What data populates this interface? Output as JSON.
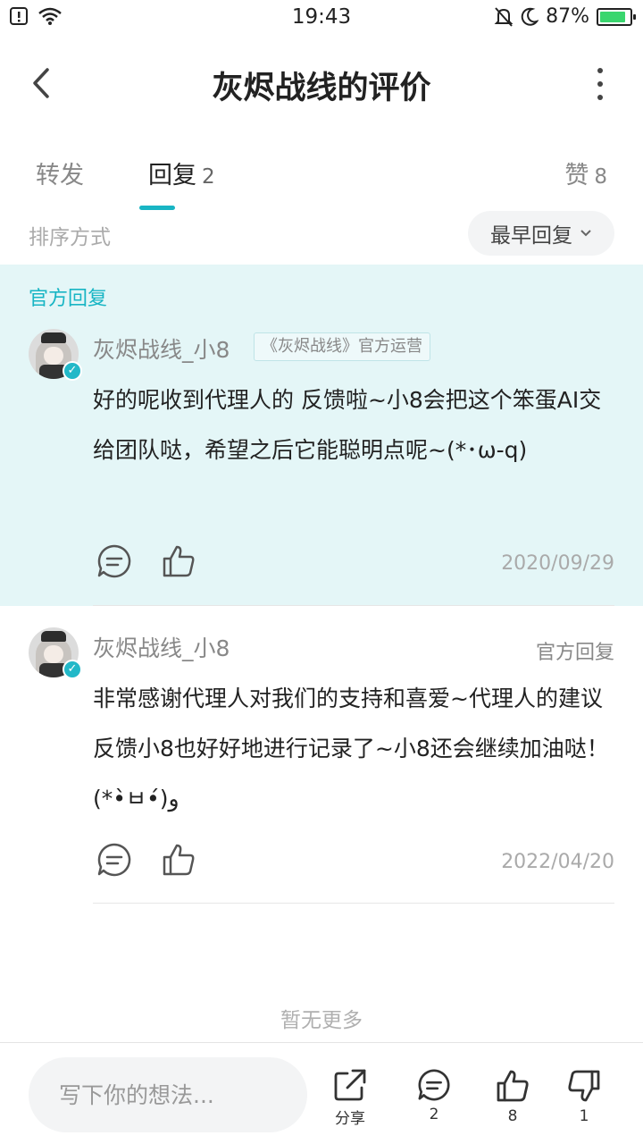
{
  "status_bar": {
    "time": "19:43",
    "battery": "87%",
    "battery_level": 0.87
  },
  "header": {
    "title": "灰烬战线的评价"
  },
  "tabs": [
    {
      "label": "转发",
      "count": ""
    },
    {
      "label": "回复",
      "count": "2"
    },
    {
      "label": "赞",
      "count": "8"
    }
  ],
  "sort": {
    "label": "排序方式",
    "value": "最早回复"
  },
  "replies": [
    {
      "section_label": "官方回复",
      "username": "灰烬战线_小8",
      "badge": "《灰烬战线》官方运营",
      "text": "好的呢收到代理人的 反馈啦~小8会把这个笨蛋AI交给团队哒，希望之后它能聪明点呢~(*･ω-q)",
      "date": "2020/09/29"
    },
    {
      "username": "灰烬战线_小8",
      "official_label": "官方回复",
      "text": "非常感谢代理人对我们的支持和喜爱~代理人的建议反馈小8也好好地进行记录了~小8还会继续加油哒！ (*•̀ㅂ•́)و",
      "date": "2022/04/20"
    }
  ],
  "no_more": "暂无更多",
  "bottom_bar": {
    "input_placeholder": "写下你的想法...",
    "share_label": "分享",
    "comment_count": "2",
    "like_count": "8",
    "dislike_count": "1"
  },
  "colors": {
    "accent": "#18b5c4",
    "official_bg": "#e4f6f7"
  }
}
